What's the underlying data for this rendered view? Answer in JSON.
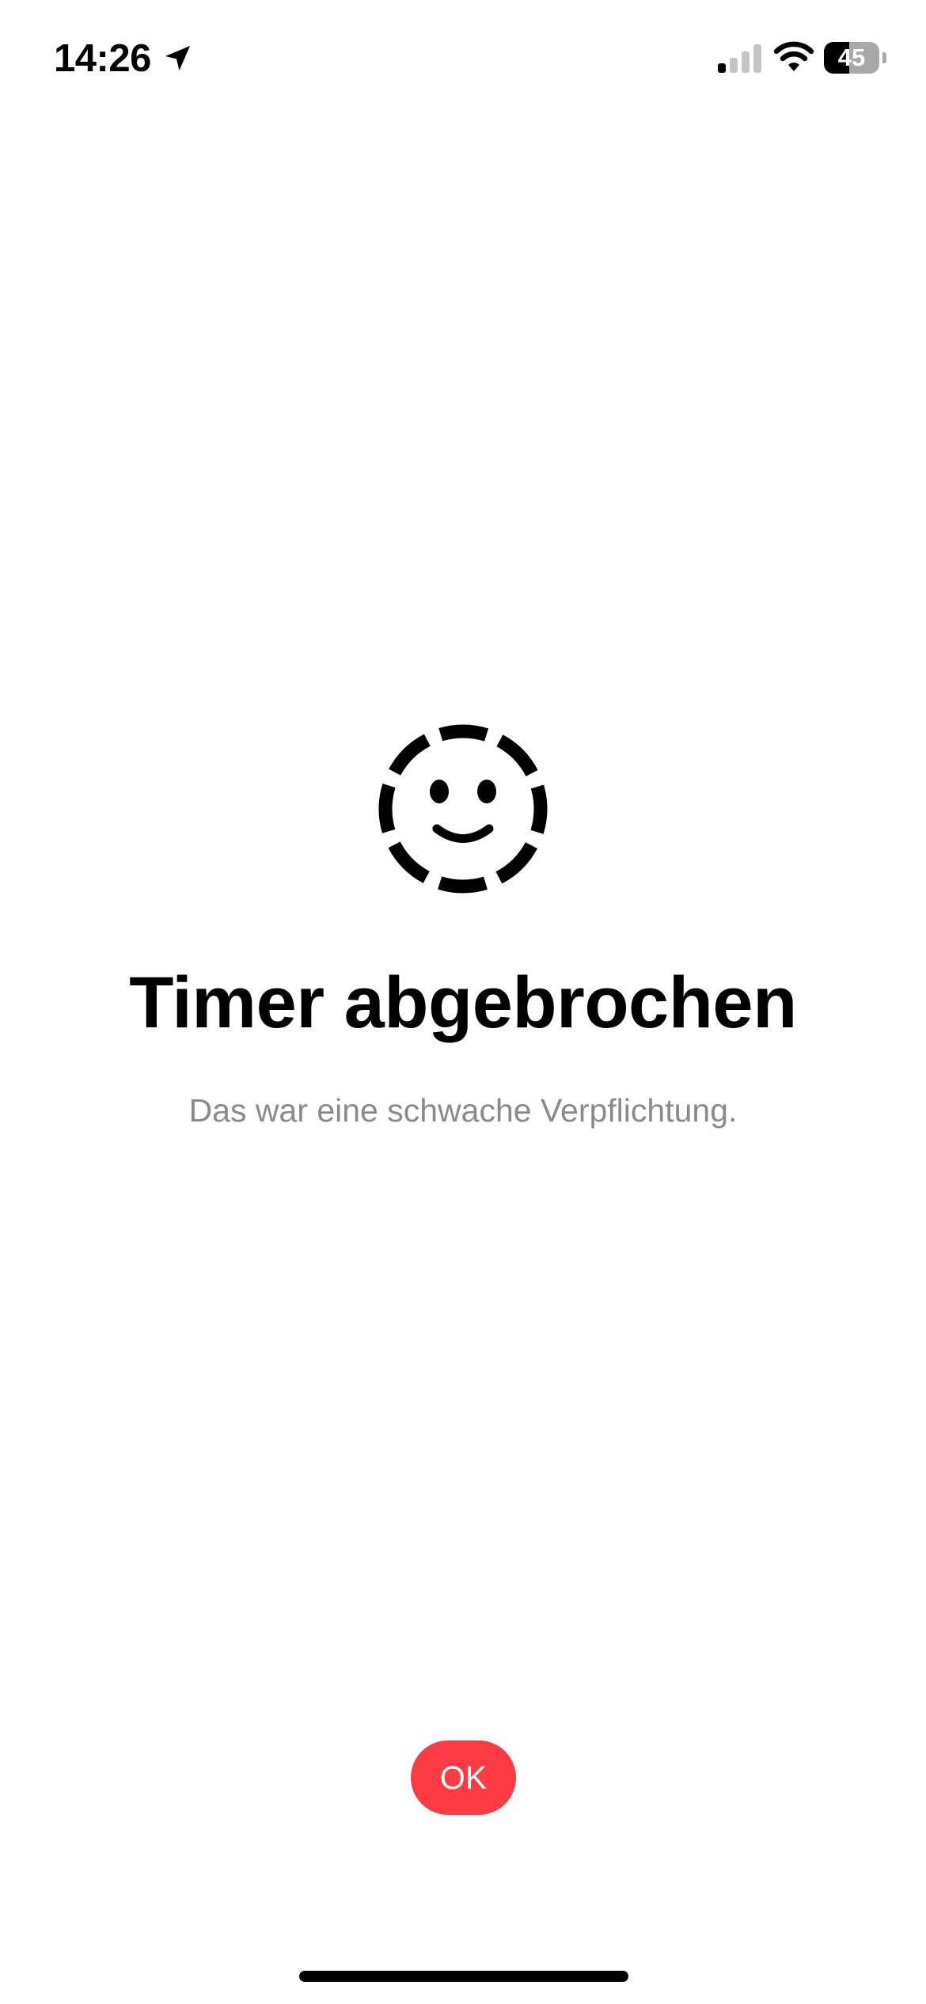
{
  "status_bar": {
    "time": "14:26",
    "battery_level": "45",
    "battery_fraction": 0.45,
    "signal_bars_active": 1,
    "signal_bars_total": 4,
    "icons": [
      "location-arrow-icon",
      "cellular-signal-icon",
      "wifi-icon",
      "battery-icon"
    ]
  },
  "main": {
    "icon": "dashed-smiley-icon",
    "title": "Timer abgebrochen",
    "subtitle": "Das war eine schwache Verpflichtung."
  },
  "actions": {
    "ok_label": "OK"
  },
  "colors": {
    "accent": "#fc3c44",
    "subtitle": "#8a8a8e",
    "text": "#000000",
    "background": "#ffffff"
  }
}
